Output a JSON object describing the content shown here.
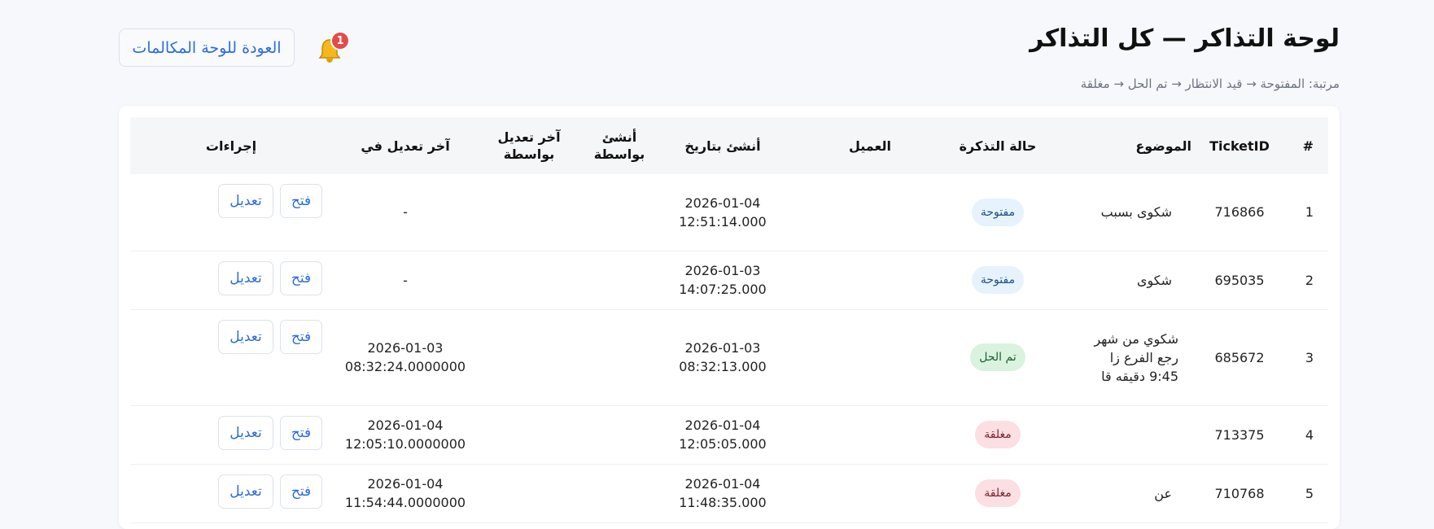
{
  "header": {
    "title": "لوحة التذاكر — كل التذاكر",
    "subtitle": "مرتبة: المفتوحة → قيد الانتظار → تم الحل → مغلقة",
    "back_button": "العودة للوحة المكالمات",
    "notification_count": "1"
  },
  "table": {
    "columns": {
      "num": "#",
      "ticket_id": "TicketID",
      "subject": "الموضوع",
      "status": "حالة التذكرة",
      "customer": "العميل",
      "created_at": "أنشئ بتاريخ",
      "created_by": "أنشئ بواسطة",
      "modified_by": "آخر تعديل بواسطة",
      "modified_at": "آخر تعديل في",
      "actions": "إجراءات"
    },
    "rows": [
      {
        "num": "1",
        "ticket_id": "716866",
        "subject": "شكوى بسبب",
        "status": "مفتوحة",
        "customer": "",
        "created_at": "2026-01-04\n12:51:14.000",
        "created_by": "",
        "modified_by": "",
        "modified_at": "-",
        "open": "فتح",
        "edit": "تعديل"
      },
      {
        "num": "2",
        "ticket_id": "695035",
        "subject": "شكوى",
        "status": "مفتوحة",
        "customer": "",
        "created_at": "2026-01-03\n14:07:25.000",
        "created_by": "",
        "modified_by": "",
        "modified_at": "-",
        "open": "فتح",
        "edit": "تعديل"
      },
      {
        "num": "3",
        "ticket_id": "685672",
        "subject": "شكوي من شهر\nرجع الفرع زا\n9:45 دقيقه قا",
        "status": "تم الحل",
        "customer": "",
        "created_at": "2026-01-03\n08:32:13.000",
        "created_by": "",
        "modified_by": "",
        "modified_at": "2026-01-03\n08:32:24.0000000",
        "open": "فتح",
        "edit": "تعديل"
      },
      {
        "num": "4",
        "ticket_id": "713375",
        "subject": "",
        "status": "مغلقة",
        "customer": "",
        "created_at": "2026-01-04\n12:05:05.000",
        "created_by": "",
        "modified_by": "",
        "modified_at": "2026-01-04\n12:05:10.0000000",
        "open": "فتح",
        "edit": "تعديل"
      },
      {
        "num": "5",
        "ticket_id": "710768",
        "subject": "عن",
        "status": "مغلقة",
        "customer": "",
        "created_at": "2026-01-04\n11:48:35.000",
        "created_by": "",
        "modified_by": "",
        "modified_at": "2026-01-04\n11:54:44.0000000",
        "open": "فتح",
        "edit": "تعديل"
      }
    ]
  },
  "status_styles": {
    "مفتوحة": "pill-open",
    "تم الحل": "pill-done",
    "مغلقة": "pill-closed"
  },
  "colors": {
    "accent": "#2d6cdf",
    "badge": "#e54a4a",
    "bell": "#f5b81c"
  }
}
